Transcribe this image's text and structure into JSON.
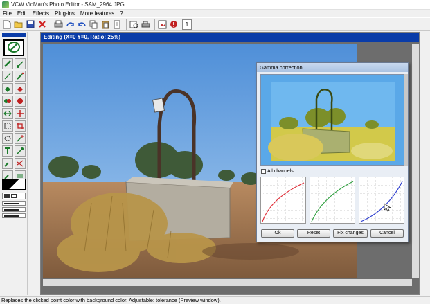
{
  "window": {
    "title": "VCW VicMan's Photo Editor - SAM_2964.JPG"
  },
  "menu": {
    "items": [
      "File",
      "Edit",
      "Effects",
      "Plug-ins",
      "More features",
      "?"
    ]
  },
  "toolbar": {
    "icons": [
      "new-icon",
      "open-icon",
      "save-icon",
      "close-icon",
      "print-icon",
      "redo-icon",
      "undo-icon",
      "copy-icon",
      "paste-icon",
      "paste-new-icon",
      "print-preview-icon",
      "scan-icon",
      "acquire-icon",
      "about-icon"
    ],
    "page_number": "1"
  },
  "editor": {
    "title": "Editing (X=0 Y=0, Ratio: 25%)"
  },
  "gamma_dialog": {
    "title": "Gamma correction",
    "all_channels_label": "All channels",
    "all_channels_checked": false,
    "curve_colors": [
      "#e0303a",
      "#30a040",
      "#3040d0"
    ],
    "buttons": {
      "ok": "Ok",
      "reset": "Reset",
      "fix": "Fix changes",
      "cancel": "Cancel"
    }
  },
  "status": {
    "text": "Replaces the clicked point color with background color. Adjustable: tolerance (Preview window)."
  }
}
